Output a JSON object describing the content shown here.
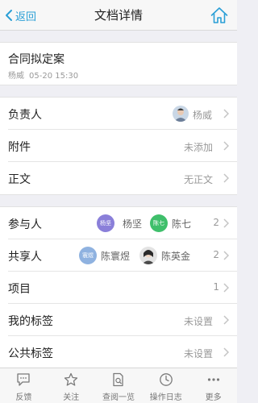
{
  "header": {
    "back_label": "返回",
    "title": "文档详情"
  },
  "document": {
    "title": "合同拟定案",
    "author": "杨威",
    "date": "05-20 15:30"
  },
  "group1": [
    {
      "label": "负责人",
      "value": "杨威"
    },
    {
      "label": "附件",
      "value": "未添加"
    },
    {
      "label": "正文",
      "value": "无正文"
    }
  ],
  "participants": {
    "label": "参与人",
    "people": [
      {
        "badge": "杨坚",
        "name": "杨坚",
        "color": "#8a7fd9"
      },
      {
        "badge": "陈七",
        "name": "陈七",
        "color": "#3fbf6b"
      }
    ],
    "count": "2"
  },
  "sharers": {
    "label": "共享人",
    "people": [
      {
        "badge": "寰煜",
        "name": "陈寰煜",
        "color": "#8fb2e0"
      },
      {
        "name": "陈英金"
      }
    ],
    "count": "2"
  },
  "project": {
    "label": "项目",
    "count": "1"
  },
  "my_tags": {
    "label": "我的标签",
    "value": "未设置"
  },
  "public_tags": {
    "label": "公共标签",
    "value": "未设置"
  },
  "tabbar": [
    {
      "label": "反馈",
      "icon": "chat-icon"
    },
    {
      "label": "关注",
      "icon": "star-icon"
    },
    {
      "label": "查阅一览",
      "icon": "document-view-icon"
    },
    {
      "label": "操作日志",
      "icon": "clock-icon"
    },
    {
      "label": "更多",
      "icon": "more-icon"
    }
  ],
  "colors": {
    "accent": "#2a9fd6",
    "background": "#efeff4"
  }
}
